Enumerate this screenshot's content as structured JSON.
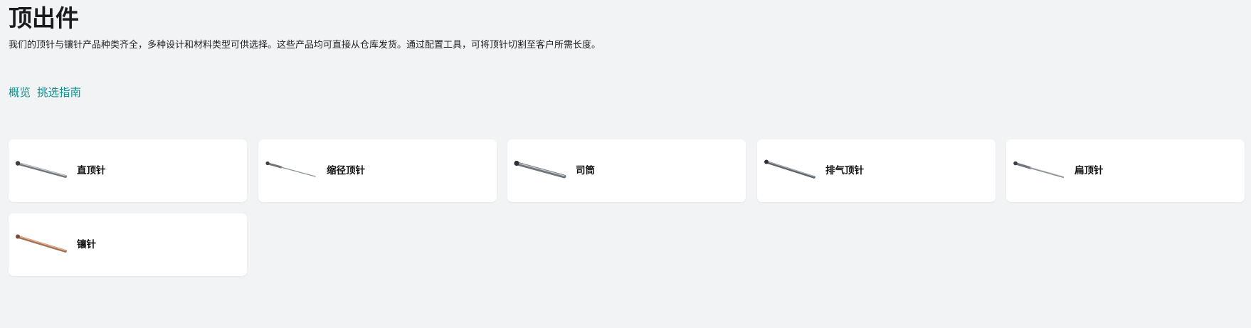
{
  "header": {
    "title": "顶出件",
    "description": "我们的顶针与镶针产品种类齐全，多种设计和材料类型可供选择。这些产品均可直接从仓库发货。通过配置工具，可将顶针切割至客户所需长度。"
  },
  "tabs": [
    {
      "label": "概览"
    },
    {
      "label": "挑选指南"
    }
  ],
  "categories": [
    {
      "label": "直顶针",
      "icon": "straight-ejector-pin-icon",
      "color": "#8d9298"
    },
    {
      "label": "缩径顶针",
      "icon": "stepped-ejector-pin-icon",
      "color": "#8d9298"
    },
    {
      "label": "司筒",
      "icon": "ejector-sleeve-icon",
      "color": "#8d9298"
    },
    {
      "label": "排气顶针",
      "icon": "vented-ejector-pin-icon",
      "color": "#8d9298"
    },
    {
      "label": "扁顶针",
      "icon": "flat-ejector-pin-icon",
      "color": "#8d9298"
    },
    {
      "label": "镶针",
      "icon": "core-pin-icon",
      "color": "#b8866a"
    }
  ]
}
